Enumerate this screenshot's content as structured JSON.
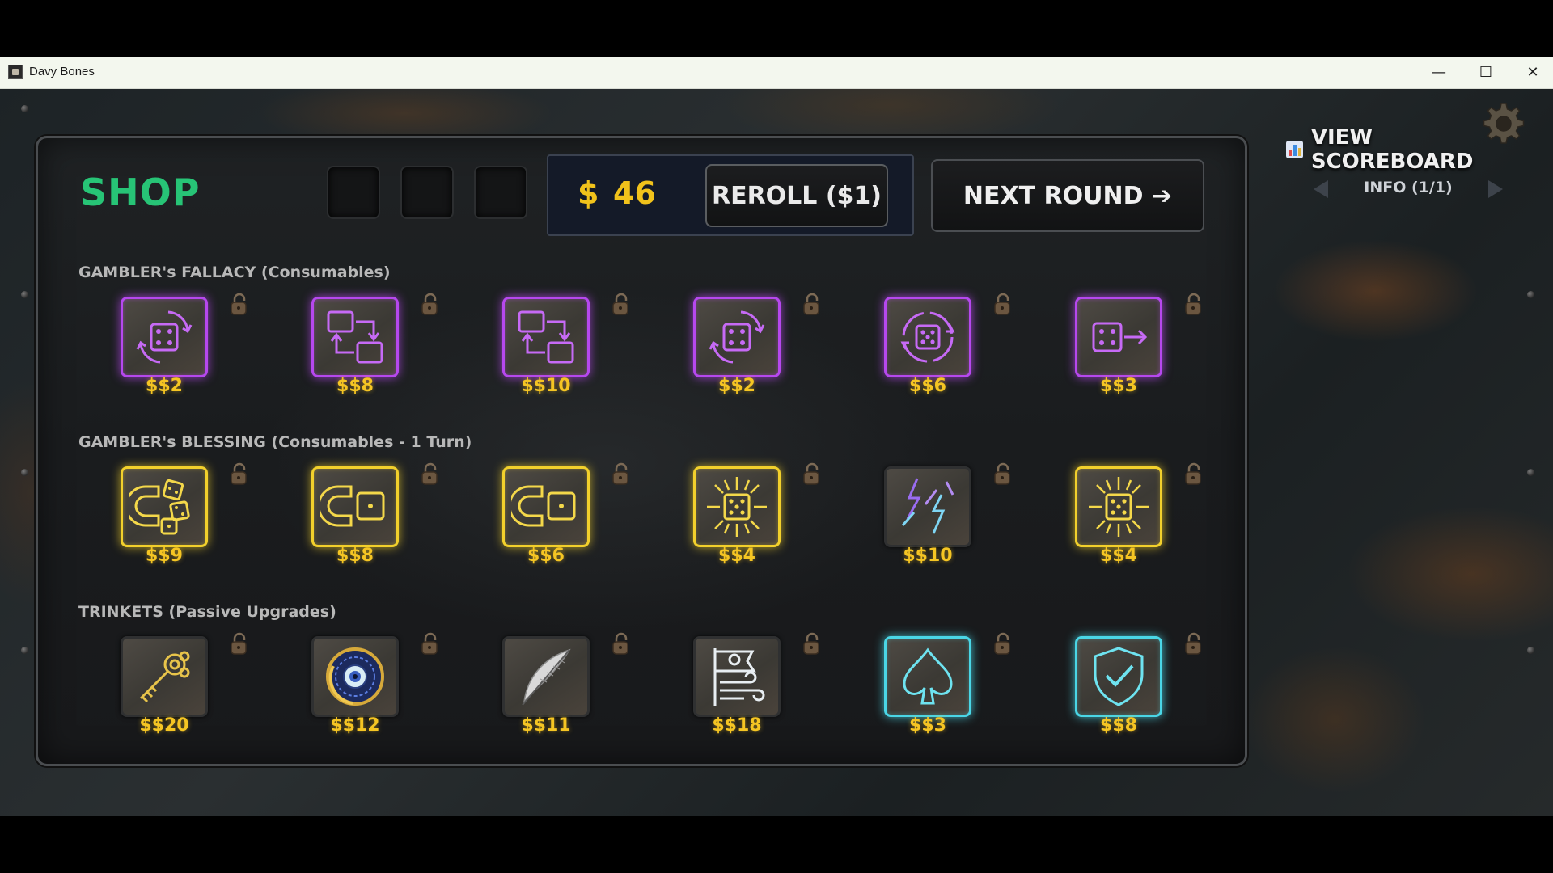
{
  "window": {
    "title": "Davy Bones",
    "controls": {
      "minimize": "—",
      "maximize": "☐",
      "close": "✕"
    }
  },
  "shop": {
    "title": "SHOP",
    "money_symbol": "$",
    "money": "46",
    "reroll_label": "REROLL ($1)",
    "next_round_label": "NEXT ROUND ➔",
    "empty_slots": 3
  },
  "sidebar": {
    "view_scoreboard_label": "VIEW SCOREBOARD",
    "info_label": "INFO (1/1)"
  },
  "sections": [
    {
      "title": "GAMBLER's FALLACY (Consumables)",
      "items": [
        {
          "icon": "reroll-die-icon",
          "price": "$$2",
          "color": "purple"
        },
        {
          "icon": "swap-dice-icon",
          "price": "$$8",
          "color": "purple"
        },
        {
          "icon": "swap-dice-icon",
          "price": "$$10",
          "color": "purple"
        },
        {
          "icon": "reroll-die-icon",
          "price": "$$2",
          "color": "purple"
        },
        {
          "icon": "reroll-all-dice-icon",
          "price": "$$6",
          "color": "purple"
        },
        {
          "icon": "move-die-icon",
          "price": "$$3",
          "color": "purple"
        }
      ]
    },
    {
      "title": "GAMBLER's BLESSING (Consumables - 1 Turn)",
      "items": [
        {
          "icon": "magnet-dice-icon",
          "price": "$$9",
          "color": "yellow"
        },
        {
          "icon": "magnet-die-icon",
          "price": "$$8",
          "color": "yellow"
        },
        {
          "icon": "magnet-die-icon",
          "price": "$$6",
          "color": "yellow"
        },
        {
          "icon": "radiant-die-icon",
          "price": "$$4",
          "color": "yellow"
        },
        {
          "icon": "lightning-icon",
          "price": "$$10",
          "color": "plain"
        },
        {
          "icon": "radiant-die-icon",
          "price": "$$4",
          "color": "yellow"
        }
      ]
    },
    {
      "title": "TRINKETS (Passive Upgrades)",
      "items": [
        {
          "icon": "golden-key-icon",
          "price": "$$20",
          "color": "plain"
        },
        {
          "icon": "eye-medallion-icon",
          "price": "$$12",
          "color": "plain"
        },
        {
          "icon": "feather-icon",
          "price": "$$11",
          "color": "plain"
        },
        {
          "icon": "pirate-flag-icon",
          "price": "$$18",
          "color": "plain"
        },
        {
          "icon": "spade-icon",
          "price": "$$3",
          "color": "cyan"
        },
        {
          "icon": "shield-check-icon",
          "price": "$$8",
          "color": "cyan"
        }
      ]
    }
  ],
  "colors": {
    "shop_title": "#27c476",
    "money": "#f1c21b",
    "price": "#f5c523",
    "fallacy_border": "#b648ee",
    "blessing_border": "#f2d02c",
    "trinket_border": "#4ad6e6"
  }
}
